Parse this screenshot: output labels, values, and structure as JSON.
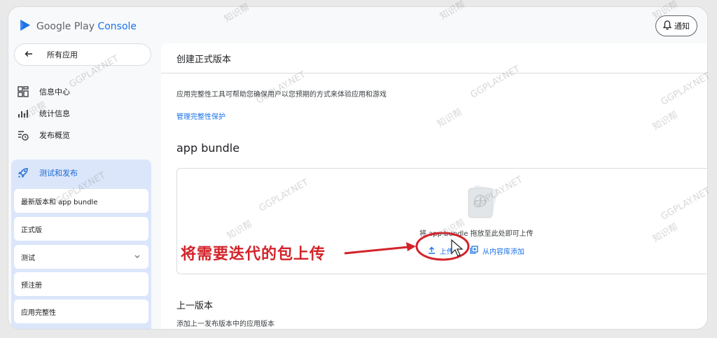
{
  "header": {
    "logo_prefix": "Google Play",
    "logo_suffix": "Console",
    "notify_label": "通知"
  },
  "sidebar": {
    "back_label": "所有应用",
    "items": [
      {
        "label": "信息中心",
        "icon": "dashboard-icon"
      },
      {
        "label": "统计信息",
        "icon": "stats-icon"
      },
      {
        "label": "发布概览",
        "icon": "release-overview-icon"
      }
    ],
    "section_label": "测试和发布",
    "section_icon": "rocket-icon",
    "sub_items": [
      {
        "label": "最新版本和 app bundle"
      },
      {
        "label": "正式版"
      },
      {
        "label": "测试",
        "expandable": true
      },
      {
        "label": "预注册"
      },
      {
        "label": "应用完整性"
      }
    ]
  },
  "main": {
    "page_title": "创建正式版本",
    "integrity_desc": "应用完整性工具可帮助您确保用户以您预期的方式来体验应用和游戏",
    "integrity_link": "管理完整性保护",
    "bundle_heading": "app bundle",
    "drop_hint": "将 app bundle 拖放至此处即可上传",
    "upload_label": "上传",
    "library_label": "从内容库添加",
    "prev_title": "上一版本",
    "prev_desc": "添加上一发布版本中的应用版本"
  },
  "annotation": {
    "text": "将需要迭代的包上传",
    "color": "#d3232a"
  },
  "watermark": {
    "site": "GGPLAY.NET",
    "brand": "知识帮"
  },
  "colors": {
    "accent": "#1a73e8",
    "section_bg": "#dbe6fb",
    "annotation": "#d3232a"
  }
}
